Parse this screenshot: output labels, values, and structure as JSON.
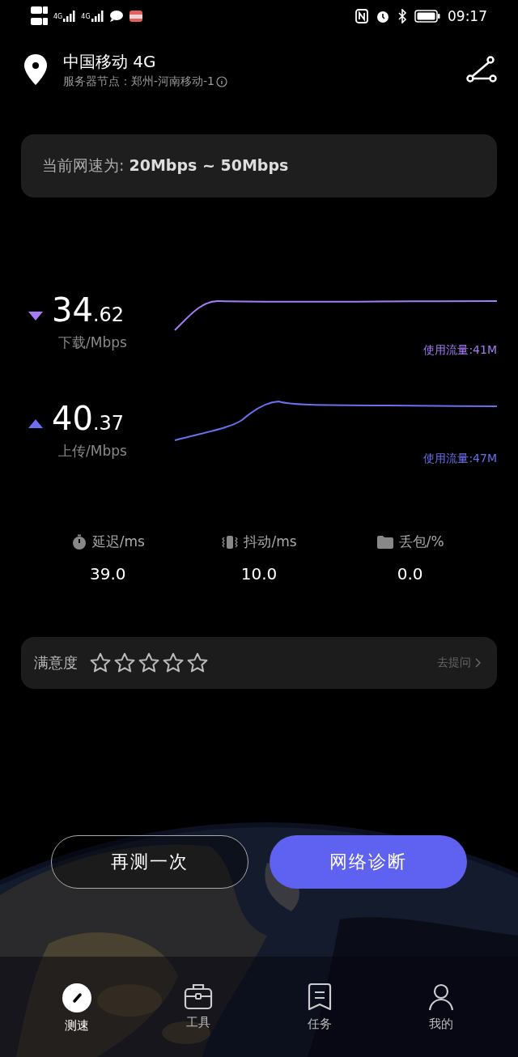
{
  "status_bar": {
    "sims": [
      {
        "label": "4G"
      },
      {
        "label": "4G"
      }
    ],
    "time": "09:17"
  },
  "header": {
    "network": "中国移动 4G",
    "server": "服务器节点：郑州-河南移动-1"
  },
  "speed_banner": {
    "label": "当前网速为:",
    "value": "20Mbps ~ 50Mbps"
  },
  "results": [
    {
      "kind": "download",
      "integer": "34",
      "decimal": ".62",
      "unit": "下载/Mbps",
      "usage": "使用流量:41M"
    },
    {
      "kind": "upload",
      "integer": "40",
      "decimal": ".37",
      "unit": "上传/Mbps",
      "usage": "使用流量:47M"
    }
  ],
  "metrics": [
    {
      "kind": "latency",
      "label": "延迟/ms",
      "value": "39.0"
    },
    {
      "kind": "jitter",
      "label": "抖动/ms",
      "value": "10.0"
    },
    {
      "kind": "loss",
      "label": "丢包/%",
      "value": "0.0"
    }
  ],
  "satisfaction": {
    "label": "满意度",
    "stars": 0,
    "link": "去提问"
  },
  "buttons": [
    {
      "kind": "outline",
      "label": "再测一次"
    },
    {
      "kind": "primary",
      "label": "网络诊断"
    }
  ],
  "tabs": [
    {
      "kind": "speed",
      "label": "测速",
      "selected": true
    },
    {
      "kind": "tools",
      "label": "工具",
      "selected": false
    },
    {
      "kind": "tasks",
      "label": "任务",
      "selected": false
    },
    {
      "kind": "me",
      "label": "我的",
      "selected": false
    }
  ]
}
